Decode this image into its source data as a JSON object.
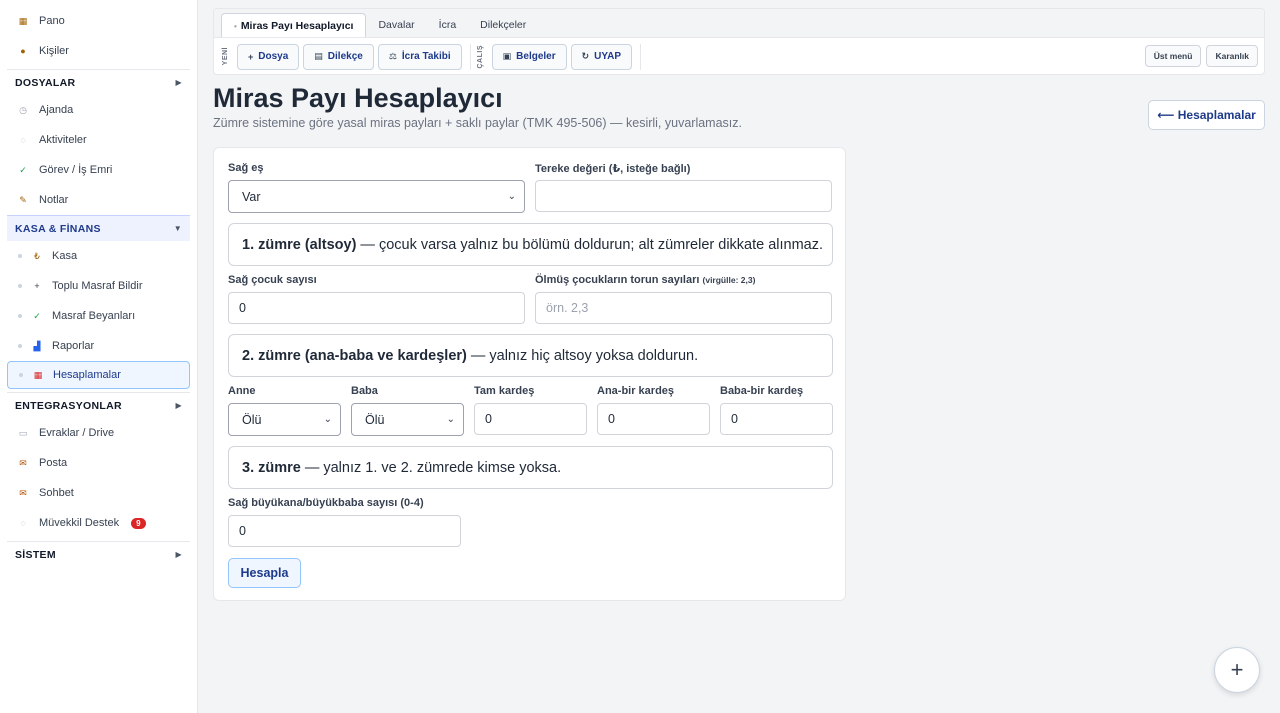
{
  "sidebar": {
    "top_items": [
      {
        "label": "Pano",
        "icon": "dashboard-icon"
      },
      {
        "label": "Kişiler",
        "icon": "people-icon"
      }
    ],
    "dosyalar": {
      "title": "DOSYALAR",
      "items": [
        {
          "label": "Ajanda",
          "icon": "clock-icon"
        },
        {
          "label": "Aktiviteler",
          "icon": "activity-icon"
        },
        {
          "label": "Görev / İş Emri",
          "icon": "check-icon"
        },
        {
          "label": "Notlar",
          "icon": "pencil-icon"
        }
      ]
    },
    "finans": {
      "title": "KASA & FİNANS",
      "items": [
        {
          "label": "Kasa",
          "icon": "lira-icon"
        },
        {
          "label": "Toplu Masraf Bildir",
          "icon": "plus-icon"
        },
        {
          "label": "Masraf Beyanları",
          "icon": "check-icon"
        },
        {
          "label": "Raporlar",
          "icon": "bar-chart-icon"
        },
        {
          "label": "Hesaplamalar",
          "icon": "calculator-icon"
        }
      ]
    },
    "entegrasyonlar": {
      "title": "ENTEGRASYONLAR",
      "items": [
        {
          "label": "Evraklar / Drive",
          "icon": "folder-icon"
        },
        {
          "label": "Posta",
          "icon": "mail-icon"
        },
        {
          "label": "Sohbet",
          "icon": "chat-mail-icon"
        },
        {
          "label": "Müvekkil Destek",
          "icon": "speech-bubble-icon",
          "badge": "9"
        }
      ]
    },
    "sistem": {
      "title": "SİSTEM"
    }
  },
  "topbar": {
    "tabs": [
      "Miras Payı Hesaplayıcı",
      "Davalar",
      "İcra",
      "Dilekçeler"
    ],
    "label_new": "YENİ",
    "label_work": "ÇALIŞ",
    "new_buttons": [
      {
        "label": "Dosya",
        "icon": "+"
      },
      {
        "label": "Dilekçe",
        "icon": "▤"
      },
      {
        "label": "İcra Takibi",
        "icon": "⚖"
      }
    ],
    "work_buttons": [
      {
        "label": "Belgeler",
        "icon": "▣"
      },
      {
        "label": "UYAP",
        "icon": "↻"
      }
    ],
    "top_menu": "Üst menü",
    "dark": "Karanlık"
  },
  "page": {
    "title": "Miras Payı Hesaplayıcı",
    "subtitle": "Zümre sistemine göre yasal miras payları + saklı paylar (TMK 495-506) — kesirli, yuvarlamasız.",
    "back_button": "⟵ Hesaplamalar"
  },
  "form": {
    "spouse_label": "Sağ eş",
    "spouse_value": "Var",
    "estate_label": "Tereke değeri (₺, isteğe bağlı)",
    "estate_value": "",
    "z1_bold": "1. zümre (altsoy)",
    "z1_text": "— çocuk varsa yalnız bu bölümü doldurun; alt zümreler dikkate alınmaz.",
    "children_label": "Sağ çocuk sayısı",
    "children_value": "0",
    "grandchildren_label": "Ölmüş çocukların torun sayıları",
    "grandchildren_hint": "(virgülle: 2,3)",
    "grandchildren_placeholder": "örn. 2,3",
    "z2_bold": "2. zümre (ana-baba ve kardeşler)",
    "z2_text": "— yalnız hiç altsoy yoksa doldurun.",
    "mother_label": "Anne",
    "mother_value": "Ölü",
    "father_label": "Baba",
    "father_value": "Ölü",
    "full_sib_label": "Tam kardeş",
    "full_sib_value": "0",
    "maternal_sib_label": "Ana-bir kardeş",
    "maternal_sib_value": "0",
    "paternal_sib_label": "Baba-bir kardeş",
    "paternal_sib_value": "0",
    "z3_bold": "3. zümre",
    "z3_text": "— yalnız 1. ve 2. zümrede kimse yoksa.",
    "grandparents_label": "Sağ büyükana/büyükbaba sayısı (0-4)",
    "grandparents_value": "0",
    "calc_button": "Hesapla"
  },
  "fab": "+"
}
